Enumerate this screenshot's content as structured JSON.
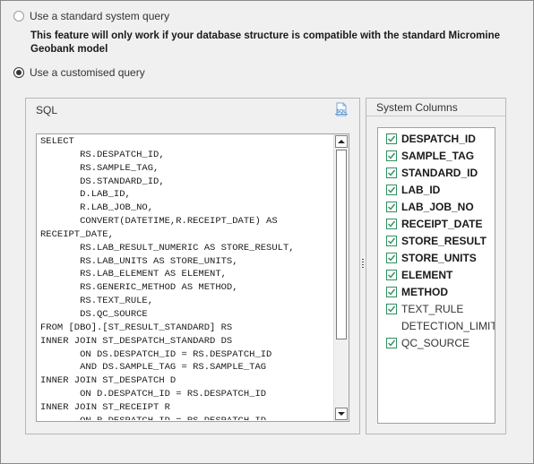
{
  "query_mode": {
    "standard_label": "Use a standard system query",
    "standard_note": "This feature will only work if your database structure is compatible with the standard Micromine Geobank model",
    "custom_label": "Use a customised query",
    "selected": "custom"
  },
  "sql_panel": {
    "title": "SQL",
    "icon": "sql-file-icon",
    "icon_text": "SQL",
    "text": "SELECT\n       RS.DESPATCH_ID,\n       RS.SAMPLE_TAG,\n       DS.STANDARD_ID,\n       D.LAB_ID,\n       R.LAB_JOB_NO,\n       CONVERT(DATETIME,R.RECEIPT_DATE) AS\nRECEIPT_DATE,\n       RS.LAB_RESULT_NUMERIC AS STORE_RESULT,\n       RS.LAB_UNITS AS STORE_UNITS,\n       RS.LAB_ELEMENT AS ELEMENT,\n       RS.GENERIC_METHOD AS METHOD,\n       RS.TEXT_RULE,\n       DS.QC_SOURCE\nFROM [DBO].[ST_RESULT_STANDARD] RS\nINNER JOIN ST_DESPATCH_STANDARD DS\n       ON DS.DESPATCH_ID = RS.DESPATCH_ID\n       AND DS.SAMPLE_TAG = RS.SAMPLE_TAG\nINNER JOIN ST_DESPATCH D\n       ON D.DESPATCH_ID = RS.DESPATCH_ID\nINNER JOIN ST_RECEIPT R\n       ON R.DESPATCH_ID = RS.DESPATCH_ID"
  },
  "system_columns": {
    "title": "System Columns",
    "items": [
      {
        "label": "DESPATCH_ID",
        "checked": true,
        "bold": true
      },
      {
        "label": "SAMPLE_TAG",
        "checked": true,
        "bold": true
      },
      {
        "label": "STANDARD_ID",
        "checked": true,
        "bold": true
      },
      {
        "label": "LAB_ID",
        "checked": true,
        "bold": true
      },
      {
        "label": "LAB_JOB_NO",
        "checked": true,
        "bold": true
      },
      {
        "label": "RECEIPT_DATE",
        "checked": true,
        "bold": true
      },
      {
        "label": "STORE_RESULT",
        "checked": true,
        "bold": true
      },
      {
        "label": "STORE_UNITS",
        "checked": true,
        "bold": true
      },
      {
        "label": "ELEMENT",
        "checked": true,
        "bold": true
      },
      {
        "label": "METHOD",
        "checked": true,
        "bold": true
      },
      {
        "label": "TEXT_RULE",
        "checked": true,
        "bold": false
      },
      {
        "label": "DETECTION_LIMIT",
        "checked": false,
        "bold": false
      },
      {
        "label": "QC_SOURCE",
        "checked": true,
        "bold": false
      }
    ]
  },
  "colors": {
    "checkbox_border": "#2f8f5f",
    "checkmark": "#2f8f5f",
    "sql_icon": "#3b7fc4"
  }
}
